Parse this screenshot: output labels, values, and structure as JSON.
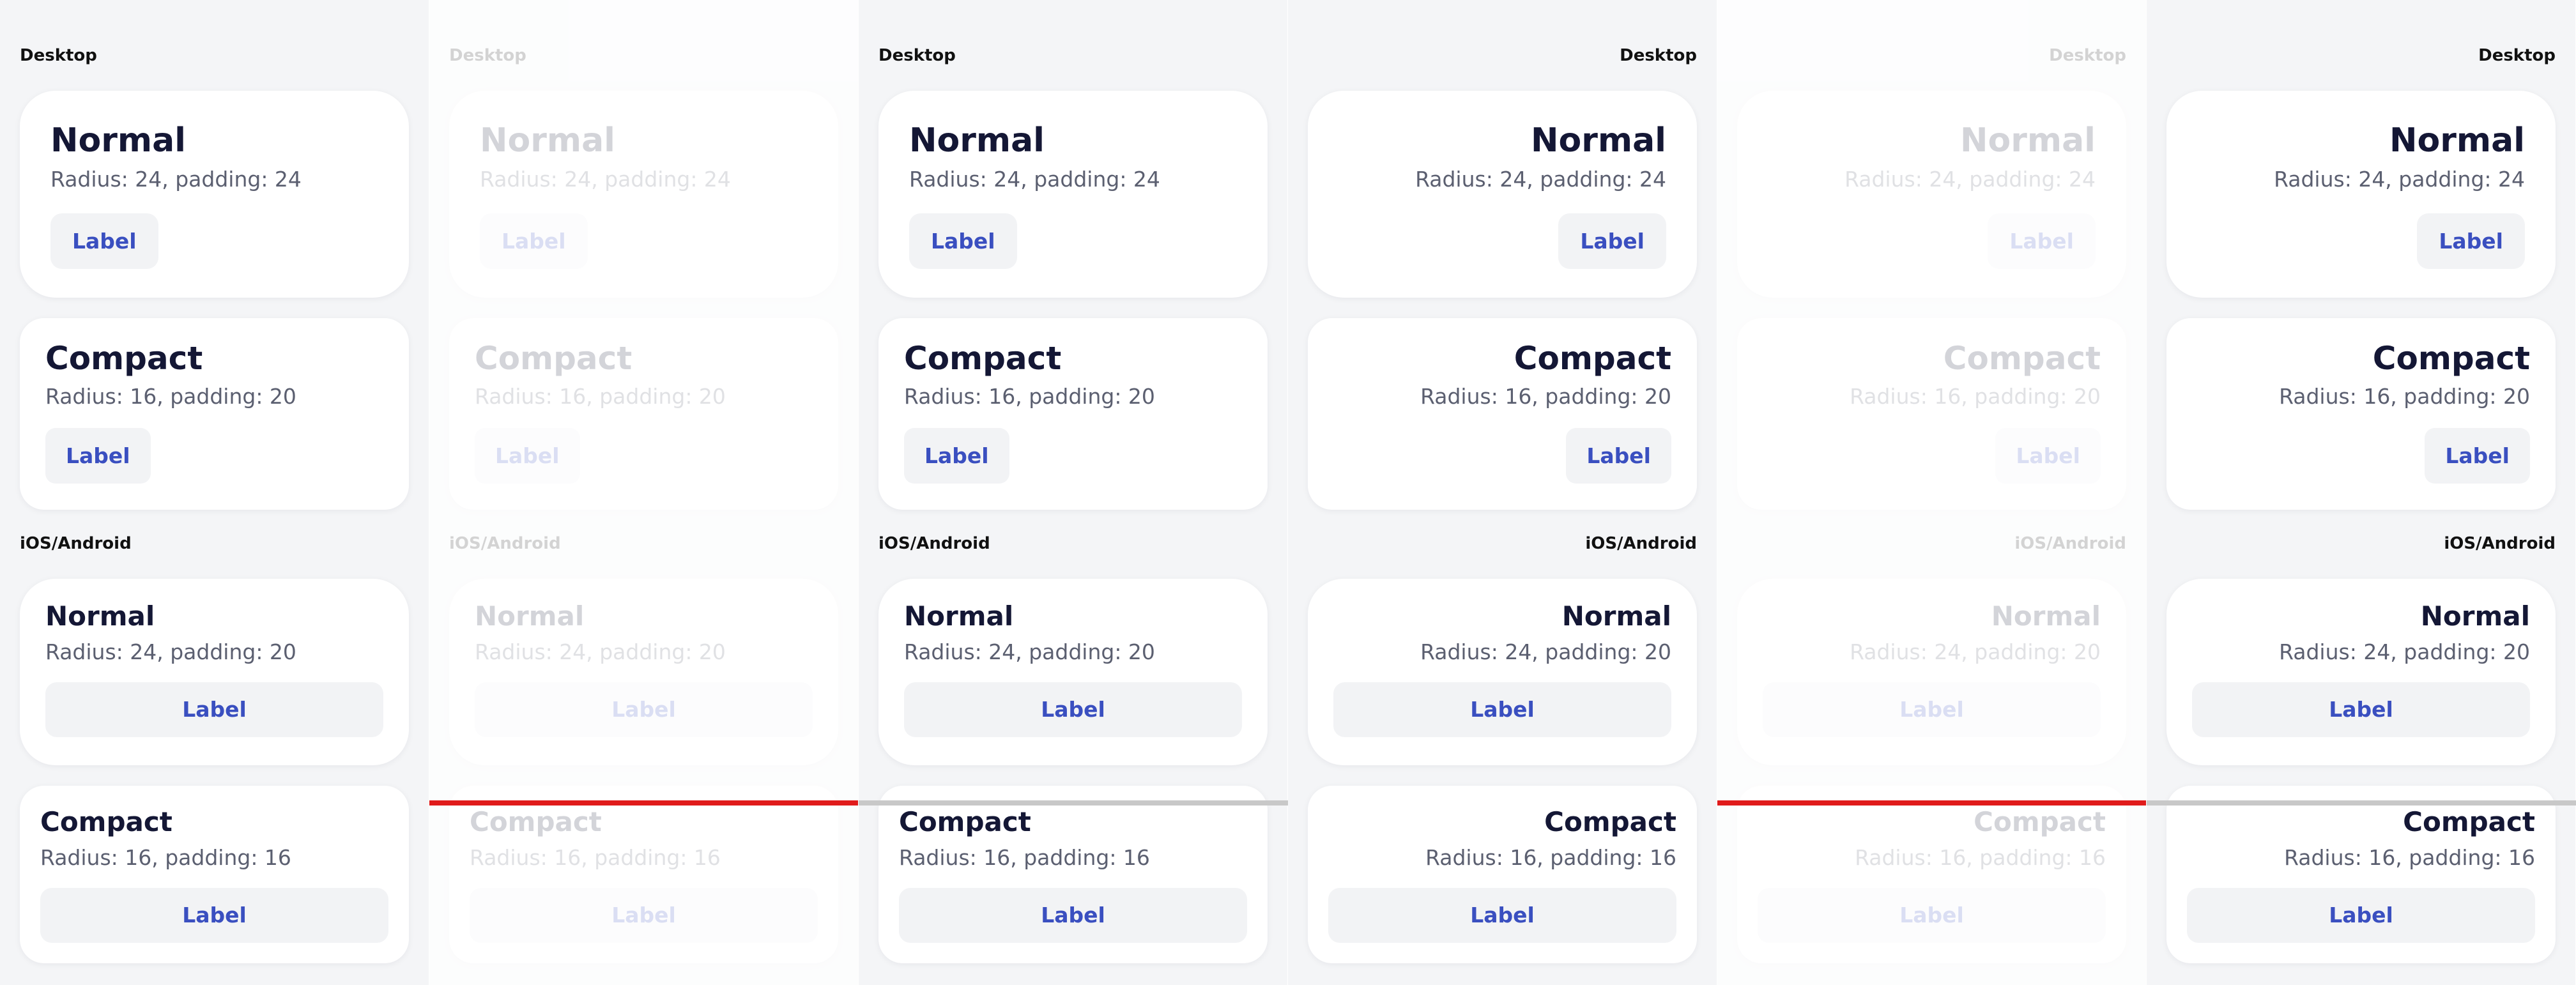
{
  "sections": {
    "desktop": "Desktop",
    "mobile": "iOS/Android"
  },
  "cards": {
    "desktop_normal": {
      "title": "Normal",
      "sub": "Radius: 24, padding: 24",
      "button": "Label"
    },
    "desktop_compact": {
      "title": "Compact",
      "sub": "Radius: 16, padding: 20",
      "button": "Label"
    },
    "mobile_normal": {
      "title": "Normal",
      "sub": "Radius: 24, padding: 20",
      "button": "Label"
    },
    "mobile_compact": {
      "title": "Compact",
      "sub": "Radius: 16, padding: 16",
      "button": "Label"
    }
  },
  "colors": {
    "title": "#141735",
    "subtitle": "#5b5f70",
    "button_text": "#3a4fc0",
    "button_bg": "#f2f3f5",
    "page_bg": "#f4f5f7",
    "indicator_active": "#e01b1b",
    "indicator_inactive": "#c8c8c8"
  }
}
